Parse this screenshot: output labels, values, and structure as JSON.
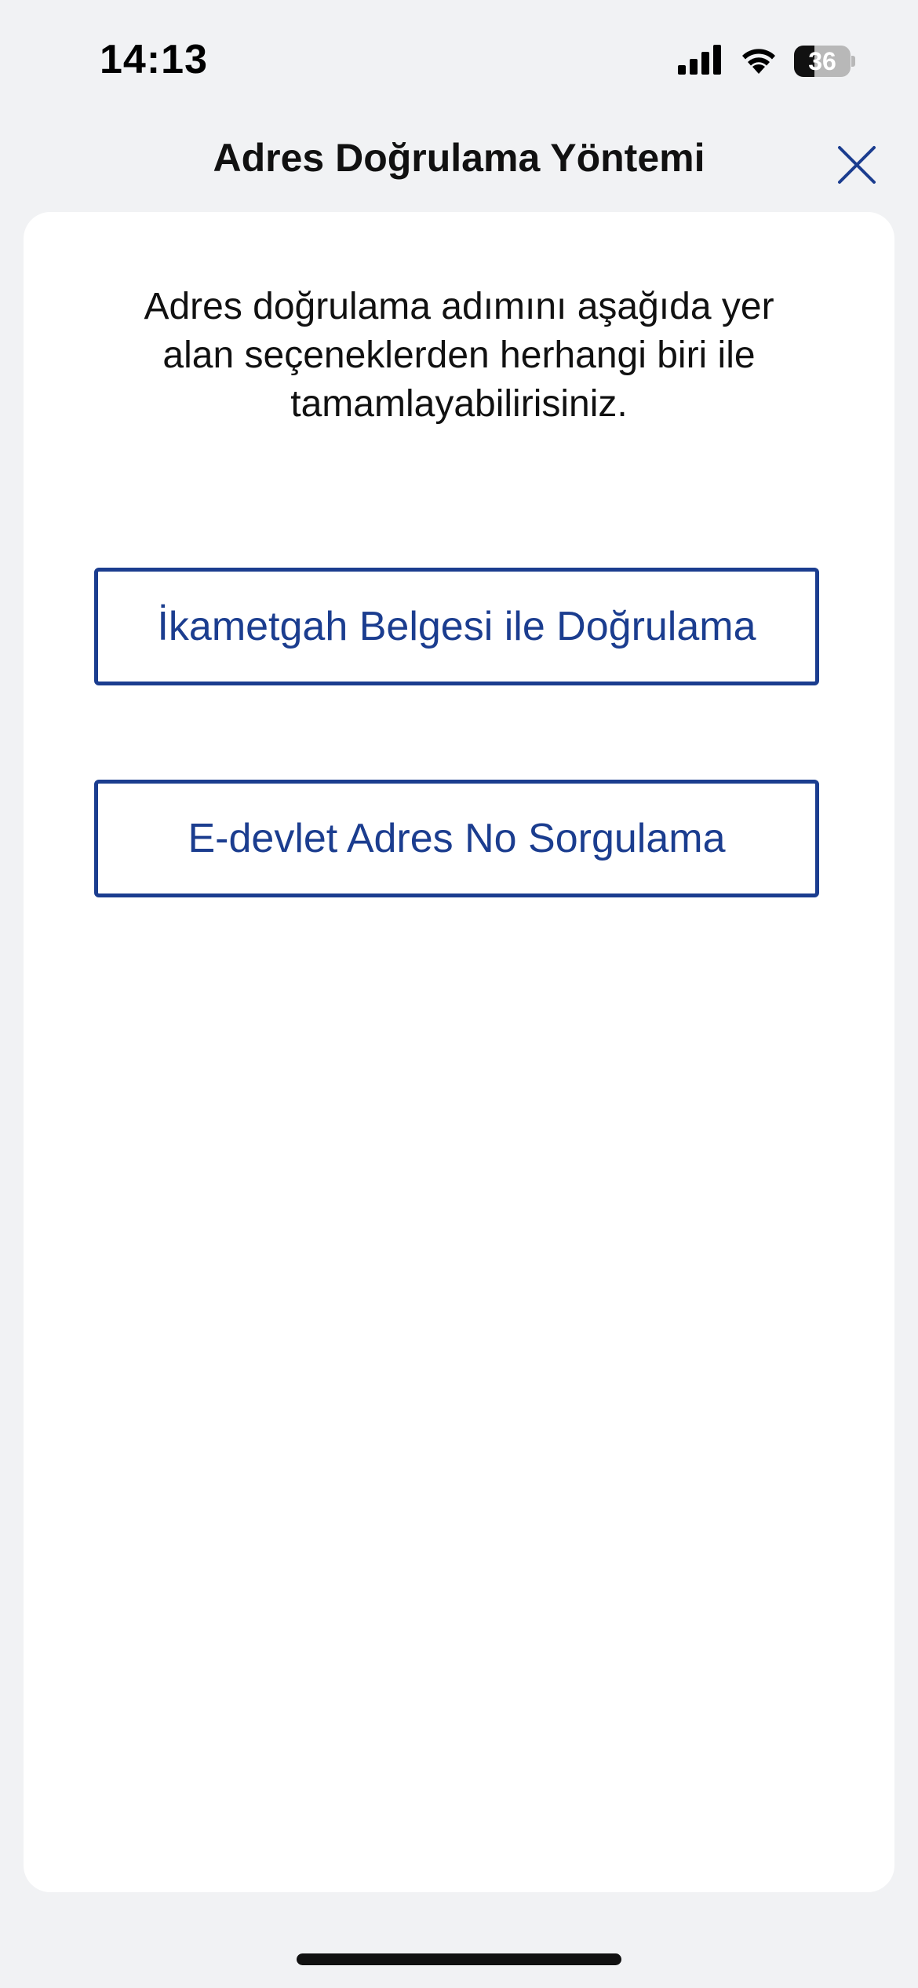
{
  "status_bar": {
    "time": "14:13",
    "battery_level": "36",
    "battery_percent": 36,
    "icons": [
      "cellular-signal-icon",
      "wifi-icon",
      "battery-icon"
    ]
  },
  "header": {
    "title": "Adres Doğrulama Yöntemi",
    "close_icon": "close-icon"
  },
  "content": {
    "intro": "Adres doğrulama adımını aşağıda yer alan seçeneklerden herhangi biri ile tamamlayabilirisiniz.",
    "options": [
      {
        "label": "İkametgah Belgesi ile Doğrulama"
      },
      {
        "label": "E-devlet Adres No Sorgulama"
      }
    ]
  },
  "colors": {
    "accent": "#1b3d8f",
    "background": "#f1f2f4",
    "card": "#ffffff"
  }
}
